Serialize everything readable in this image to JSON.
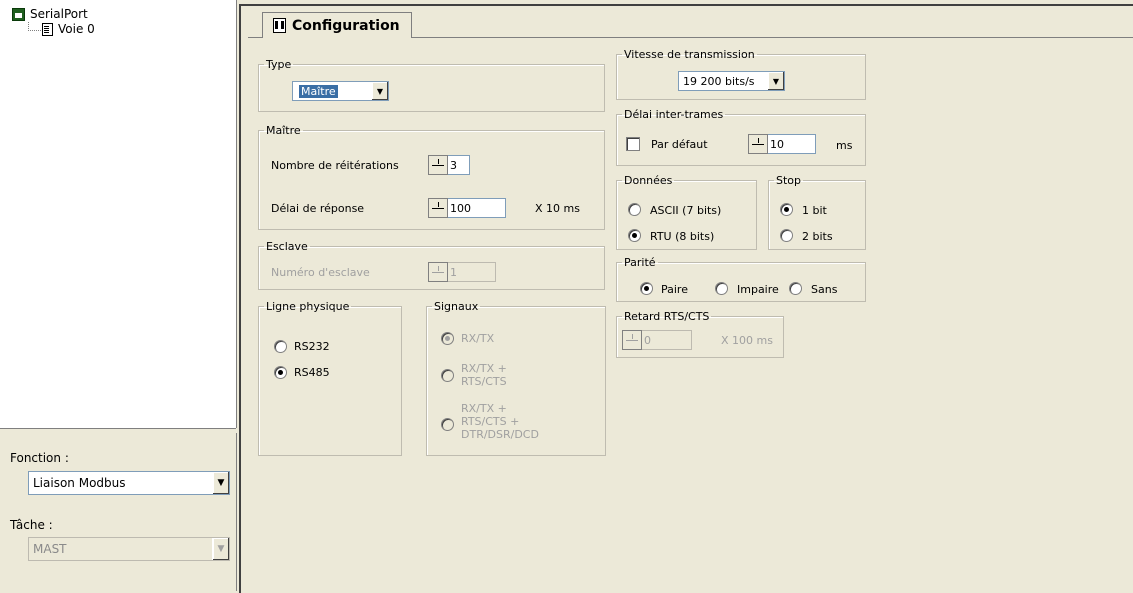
{
  "tree": {
    "root_label": "SerialPort",
    "child_label": "Voie 0"
  },
  "left_bottom": {
    "fonction_label": "Fonction :",
    "fonction_value": "Liaison Modbus",
    "tache_label": "Tâche :",
    "tache_value": "MAST"
  },
  "tab": {
    "label": "Configuration"
  },
  "type": {
    "legend": "Type",
    "value": "Maître"
  },
  "maitre": {
    "legend": "Maître",
    "reiterations_label": "Nombre de réitérations",
    "reiterations_value": "3",
    "delai_label": "Délai de réponse",
    "delai_value": "100",
    "delai_unit": "X 10 ms"
  },
  "esclave": {
    "legend": "Esclave",
    "numero_label": "Numéro d'esclave",
    "numero_value": "1"
  },
  "ligne": {
    "legend": "Ligne physique",
    "opt1": "RS232",
    "opt2": "RS485",
    "selected": "RS485"
  },
  "signaux": {
    "legend": "Signaux",
    "opt1": "RX/TX",
    "opt2_l1": "RX/TX +",
    "opt2_l2": "RTS/CTS",
    "opt3_l1": "RX/TX +",
    "opt3_l2": "RTS/CTS +",
    "opt3_l3": "DTR/DSR/DCD"
  },
  "vitesse": {
    "legend": "Vitesse de transmission",
    "value": "19 200 bits/s"
  },
  "delai_inter": {
    "legend": "Délai inter-trames",
    "checkbox_label": "Par défaut",
    "value": "10",
    "unit": "ms"
  },
  "donnees": {
    "legend": "Données",
    "opt1": "ASCII (7 bits)",
    "opt2": "RTU (8 bits)"
  },
  "stop": {
    "legend": "Stop",
    "opt1": "1 bit",
    "opt2": "2 bits"
  },
  "parite": {
    "legend": "Parité",
    "opt1": "Paire",
    "opt2": "Impaire",
    "opt3": "Sans"
  },
  "retard": {
    "legend": "Retard RTS/CTS",
    "value": "0",
    "unit": "X 100 ms"
  }
}
